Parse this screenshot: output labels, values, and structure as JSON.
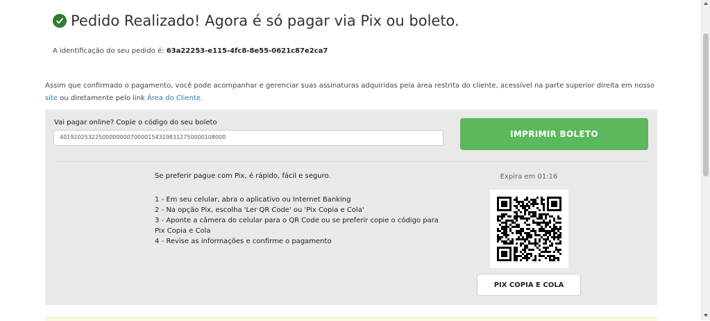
{
  "header": {
    "title": "Pedido Realizado! Agora é só pagar via Pix ou boleto.",
    "order_label": "A identificação do seu pedido é:",
    "order_id": "63a22253-e115-4fc8-8e55-0621c87e2ca7"
  },
  "info": {
    "text_1": "Assim que confirmado o pagamento, você pode acompanhar e gerenciar suas assinaturas adquiridas pela área restrita do cliente, acessível na parte superior direita em nosso ",
    "link_site": "site",
    "text_2": " ou diretamente pelo link ",
    "link_area": "Área do Cliente",
    "text_3": "."
  },
  "boleto": {
    "label": "Vai pagar online? Copie o código do seu boleto",
    "code": "40192025322500000000700001543198312750000108000",
    "print_button": "IMPRIMIR BOLETO"
  },
  "pix": {
    "intro": "Se preferir pague com Pix, é rápido, fácil e seguro.",
    "steps": [
      "1 - Em seu celular, abra o aplicativo ou Internet Banking",
      "2 - Na opção Pix, escolha 'Ler QR Code' ou 'Pix Copia e Cola'",
      "3 - Aponte a câmera do celular para o QR Code ou se preferir copie o código para Pix Copia e Cola",
      "4 - Revise as informações e confirme o pagamento"
    ],
    "expires": "Expira em 01:16",
    "copy_button": "PIX COPIA E COLA"
  },
  "icons": {
    "success": "check-circle-icon",
    "qr": "qr-code-icon"
  },
  "colors": {
    "success": "#2e7d32",
    "button_green": "#5cb85c",
    "link": "#2a76b8",
    "panel": "#e9e9e9"
  }
}
